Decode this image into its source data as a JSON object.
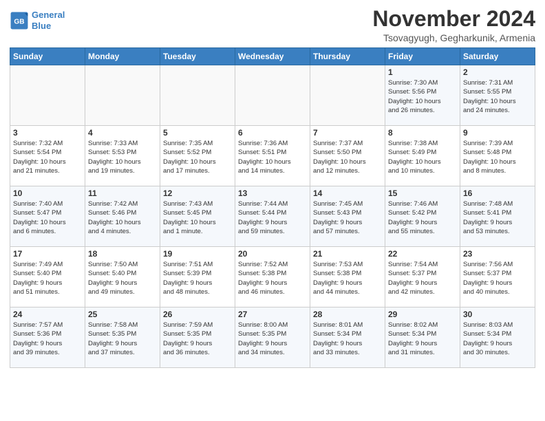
{
  "logo": {
    "line1": "General",
    "line2": "Blue"
  },
  "title": "November 2024",
  "location": "Tsovagyugh, Gegharkunik, Armenia",
  "weekdays": [
    "Sunday",
    "Monday",
    "Tuesday",
    "Wednesday",
    "Thursday",
    "Friday",
    "Saturday"
  ],
  "weeks": [
    [
      {
        "day": "",
        "info": ""
      },
      {
        "day": "",
        "info": ""
      },
      {
        "day": "",
        "info": ""
      },
      {
        "day": "",
        "info": ""
      },
      {
        "day": "",
        "info": ""
      },
      {
        "day": "1",
        "info": "Sunrise: 7:30 AM\nSunset: 5:56 PM\nDaylight: 10 hours\nand 26 minutes."
      },
      {
        "day": "2",
        "info": "Sunrise: 7:31 AM\nSunset: 5:55 PM\nDaylight: 10 hours\nand 24 minutes."
      }
    ],
    [
      {
        "day": "3",
        "info": "Sunrise: 7:32 AM\nSunset: 5:54 PM\nDaylight: 10 hours\nand 21 minutes."
      },
      {
        "day": "4",
        "info": "Sunrise: 7:33 AM\nSunset: 5:53 PM\nDaylight: 10 hours\nand 19 minutes."
      },
      {
        "day": "5",
        "info": "Sunrise: 7:35 AM\nSunset: 5:52 PM\nDaylight: 10 hours\nand 17 minutes."
      },
      {
        "day": "6",
        "info": "Sunrise: 7:36 AM\nSunset: 5:51 PM\nDaylight: 10 hours\nand 14 minutes."
      },
      {
        "day": "7",
        "info": "Sunrise: 7:37 AM\nSunset: 5:50 PM\nDaylight: 10 hours\nand 12 minutes."
      },
      {
        "day": "8",
        "info": "Sunrise: 7:38 AM\nSunset: 5:49 PM\nDaylight: 10 hours\nand 10 minutes."
      },
      {
        "day": "9",
        "info": "Sunrise: 7:39 AM\nSunset: 5:48 PM\nDaylight: 10 hours\nand 8 minutes."
      }
    ],
    [
      {
        "day": "10",
        "info": "Sunrise: 7:40 AM\nSunset: 5:47 PM\nDaylight: 10 hours\nand 6 minutes."
      },
      {
        "day": "11",
        "info": "Sunrise: 7:42 AM\nSunset: 5:46 PM\nDaylight: 10 hours\nand 4 minutes."
      },
      {
        "day": "12",
        "info": "Sunrise: 7:43 AM\nSunset: 5:45 PM\nDaylight: 10 hours\nand 1 minute."
      },
      {
        "day": "13",
        "info": "Sunrise: 7:44 AM\nSunset: 5:44 PM\nDaylight: 9 hours\nand 59 minutes."
      },
      {
        "day": "14",
        "info": "Sunrise: 7:45 AM\nSunset: 5:43 PM\nDaylight: 9 hours\nand 57 minutes."
      },
      {
        "day": "15",
        "info": "Sunrise: 7:46 AM\nSunset: 5:42 PM\nDaylight: 9 hours\nand 55 minutes."
      },
      {
        "day": "16",
        "info": "Sunrise: 7:48 AM\nSunset: 5:41 PM\nDaylight: 9 hours\nand 53 minutes."
      }
    ],
    [
      {
        "day": "17",
        "info": "Sunrise: 7:49 AM\nSunset: 5:40 PM\nDaylight: 9 hours\nand 51 minutes."
      },
      {
        "day": "18",
        "info": "Sunrise: 7:50 AM\nSunset: 5:40 PM\nDaylight: 9 hours\nand 49 minutes."
      },
      {
        "day": "19",
        "info": "Sunrise: 7:51 AM\nSunset: 5:39 PM\nDaylight: 9 hours\nand 48 minutes."
      },
      {
        "day": "20",
        "info": "Sunrise: 7:52 AM\nSunset: 5:38 PM\nDaylight: 9 hours\nand 46 minutes."
      },
      {
        "day": "21",
        "info": "Sunrise: 7:53 AM\nSunset: 5:38 PM\nDaylight: 9 hours\nand 44 minutes."
      },
      {
        "day": "22",
        "info": "Sunrise: 7:54 AM\nSunset: 5:37 PM\nDaylight: 9 hours\nand 42 minutes."
      },
      {
        "day": "23",
        "info": "Sunrise: 7:56 AM\nSunset: 5:37 PM\nDaylight: 9 hours\nand 40 minutes."
      }
    ],
    [
      {
        "day": "24",
        "info": "Sunrise: 7:57 AM\nSunset: 5:36 PM\nDaylight: 9 hours\nand 39 minutes."
      },
      {
        "day": "25",
        "info": "Sunrise: 7:58 AM\nSunset: 5:35 PM\nDaylight: 9 hours\nand 37 minutes."
      },
      {
        "day": "26",
        "info": "Sunrise: 7:59 AM\nSunset: 5:35 PM\nDaylight: 9 hours\nand 36 minutes."
      },
      {
        "day": "27",
        "info": "Sunrise: 8:00 AM\nSunset: 5:35 PM\nDaylight: 9 hours\nand 34 minutes."
      },
      {
        "day": "28",
        "info": "Sunrise: 8:01 AM\nSunset: 5:34 PM\nDaylight: 9 hours\nand 33 minutes."
      },
      {
        "day": "29",
        "info": "Sunrise: 8:02 AM\nSunset: 5:34 PM\nDaylight: 9 hours\nand 31 minutes."
      },
      {
        "day": "30",
        "info": "Sunrise: 8:03 AM\nSunset: 5:34 PM\nDaylight: 9 hours\nand 30 minutes."
      }
    ]
  ]
}
